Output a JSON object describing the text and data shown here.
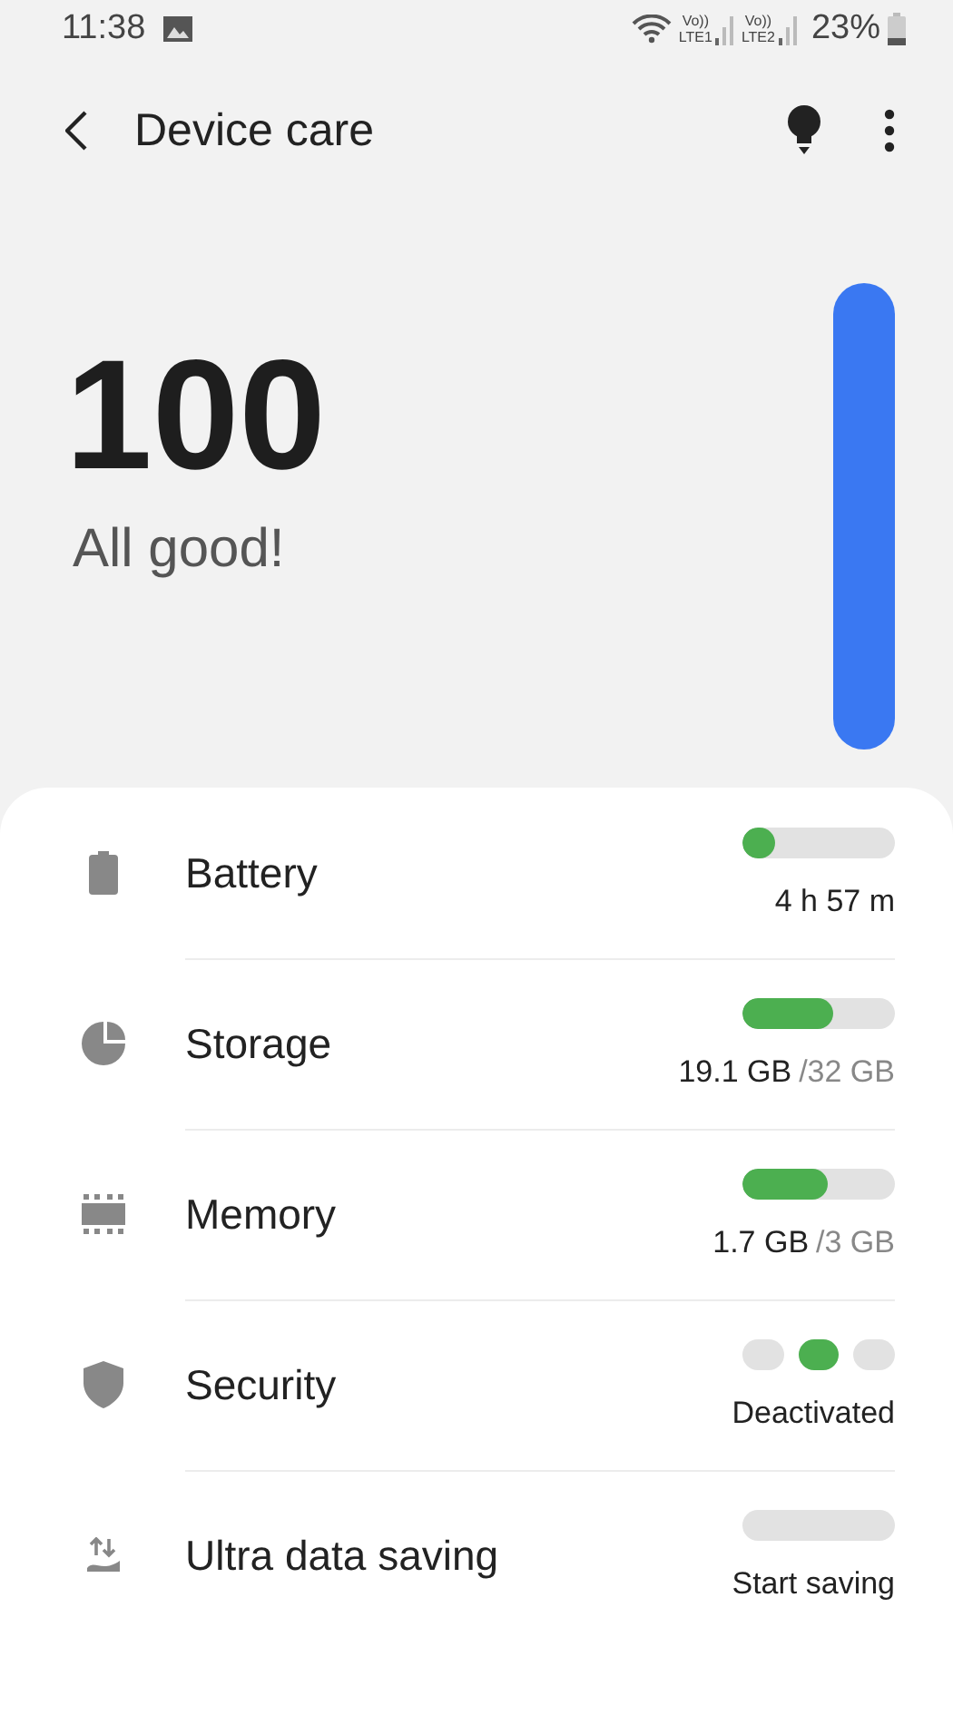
{
  "status_bar": {
    "time": "11:38",
    "sims": [
      {
        "volte": "Vo))",
        "label": "LTE1"
      },
      {
        "volte": "Vo))",
        "label": "LTE2"
      }
    ],
    "battery": "23%"
  },
  "app_bar": {
    "title": "Device care"
  },
  "score": {
    "value": "100",
    "message": "All good!"
  },
  "items": [
    {
      "kind": "bar",
      "label": "Battery",
      "level": 0.22,
      "value": "4 h 57 m"
    },
    {
      "kind": "bar",
      "label": "Storage",
      "level": 0.6,
      "value": "19.1 GB",
      "total": "/32 GB"
    },
    {
      "kind": "bar",
      "label": "Memory",
      "level": 0.56,
      "value": "1.7 GB",
      "total": "/3 GB"
    },
    {
      "kind": "dots",
      "label": "Security",
      "dots": [
        {
          "selected": false
        },
        {
          "selected": true
        },
        {
          "selected": false
        }
      ],
      "value": "Deactivated"
    },
    {
      "kind": "empty",
      "label": "Ultra data saving",
      "value": "Start saving"
    }
  ]
}
